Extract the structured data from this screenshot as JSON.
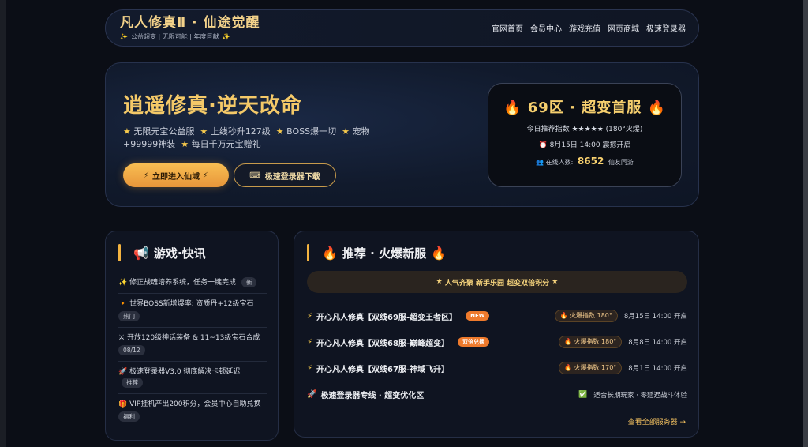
{
  "header": {
    "title": "凡人修真Ⅱ · 仙途觉醒",
    "subtitle": "公益超变 | 无限可能 | 年度巨献",
    "nav": [
      "官网首页",
      "会员中心",
      "游戏充值",
      "网页商城",
      "极速登录器"
    ]
  },
  "hero": {
    "title": "逍遥修真·逆天改命",
    "features": [
      "无限元宝公益服",
      "上线秒升127级",
      "BOSS爆一切",
      "宠物+99999神装",
      "每日千万元宝赠礼"
    ],
    "primary_button": "立即进入仙域",
    "secondary_button": "极速登录器下载",
    "server_card": {
      "title": "69区 · 超变首服",
      "recommend": "今日推荐指数 ★★★★★ (180°火爆)",
      "open_time": "8月15日 14:00 震撼开启",
      "online_label": "在线人数:",
      "online_count": "8652",
      "online_suffix": "仙友同游"
    }
  },
  "news": {
    "title": "游戏·快讯",
    "items": [
      {
        "icon": "✨",
        "text": "修正战魂培养系统，任务一键完成",
        "tag": "新"
      },
      {
        "icon": "🔸",
        "text": "世界BOSS新增爆率: 资质丹+12级宝石",
        "tag": "热门"
      },
      {
        "icon": "⚔",
        "text": "开放120级神话装备 & 11~13级宝石合成",
        "tag": "08/12"
      },
      {
        "icon": "🚀",
        "text": "极速登录器V3.0 彻底解决卡顿延迟",
        "tag": "推荐"
      },
      {
        "icon": "🎁",
        "text": "VIP挂机产出200积分，会员中心自助兑换",
        "tag": "福利"
      }
    ]
  },
  "servers": {
    "title": "推荐 · 火爆新服",
    "banner": "人气齐聚 新手乐园 超变双倍积分",
    "rows": [
      {
        "name": "开心凡人修真【双线69服-超变王者区】",
        "badge": "NEW",
        "heat": "火爆指数 180°",
        "time": "8月15日 14:00 开启"
      },
      {
        "name": "开心凡人修真【双线68服-巅峰超变】",
        "badge": "双倍兑换",
        "heat": "火爆指数 180°",
        "time": "8月8日 14:00 开启"
      },
      {
        "name": "开心凡人修真【双线67服-神域飞升】",
        "badge": "",
        "heat": "火爆指数 170°",
        "time": "8月1日 14:00 开启"
      },
      {
        "name": "极速登录器专线 · 超变优化区",
        "badge": "",
        "heat": "",
        "time": "适合长期玩家 · 零延迟战斗体验"
      }
    ],
    "more_link": "查看全部服务器 →"
  },
  "colors": {
    "accent": "#f4c968",
    "button": "#f3b340",
    "background": "#0b0e16"
  }
}
